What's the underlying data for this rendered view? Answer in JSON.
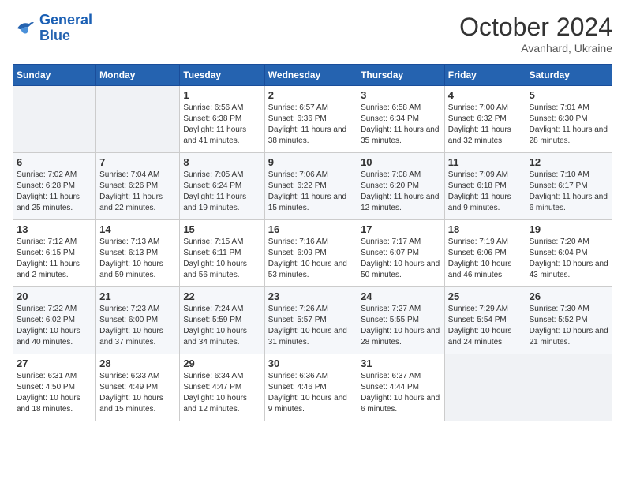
{
  "logo": {
    "text_general": "General",
    "text_blue": "Blue"
  },
  "header": {
    "month": "October 2024",
    "location": "Avanhard, Ukraine"
  },
  "weekdays": [
    "Sunday",
    "Monday",
    "Tuesday",
    "Wednesday",
    "Thursday",
    "Friday",
    "Saturday"
  ],
  "weeks": [
    [
      {
        "day": "",
        "empty": true
      },
      {
        "day": "",
        "empty": true
      },
      {
        "day": "1",
        "sunrise": "Sunrise: 6:56 AM",
        "sunset": "Sunset: 6:38 PM",
        "daylight": "Daylight: 11 hours and 41 minutes."
      },
      {
        "day": "2",
        "sunrise": "Sunrise: 6:57 AM",
        "sunset": "Sunset: 6:36 PM",
        "daylight": "Daylight: 11 hours and 38 minutes."
      },
      {
        "day": "3",
        "sunrise": "Sunrise: 6:58 AM",
        "sunset": "Sunset: 6:34 PM",
        "daylight": "Daylight: 11 hours and 35 minutes."
      },
      {
        "day": "4",
        "sunrise": "Sunrise: 7:00 AM",
        "sunset": "Sunset: 6:32 PM",
        "daylight": "Daylight: 11 hours and 32 minutes."
      },
      {
        "day": "5",
        "sunrise": "Sunrise: 7:01 AM",
        "sunset": "Sunset: 6:30 PM",
        "daylight": "Daylight: 11 hours and 28 minutes."
      }
    ],
    [
      {
        "day": "6",
        "sunrise": "Sunrise: 7:02 AM",
        "sunset": "Sunset: 6:28 PM",
        "daylight": "Daylight: 11 hours and 25 minutes."
      },
      {
        "day": "7",
        "sunrise": "Sunrise: 7:04 AM",
        "sunset": "Sunset: 6:26 PM",
        "daylight": "Daylight: 11 hours and 22 minutes."
      },
      {
        "day": "8",
        "sunrise": "Sunrise: 7:05 AM",
        "sunset": "Sunset: 6:24 PM",
        "daylight": "Daylight: 11 hours and 19 minutes."
      },
      {
        "day": "9",
        "sunrise": "Sunrise: 7:06 AM",
        "sunset": "Sunset: 6:22 PM",
        "daylight": "Daylight: 11 hours and 15 minutes."
      },
      {
        "day": "10",
        "sunrise": "Sunrise: 7:08 AM",
        "sunset": "Sunset: 6:20 PM",
        "daylight": "Daylight: 11 hours and 12 minutes."
      },
      {
        "day": "11",
        "sunrise": "Sunrise: 7:09 AM",
        "sunset": "Sunset: 6:18 PM",
        "daylight": "Daylight: 11 hours and 9 minutes."
      },
      {
        "day": "12",
        "sunrise": "Sunrise: 7:10 AM",
        "sunset": "Sunset: 6:17 PM",
        "daylight": "Daylight: 11 hours and 6 minutes."
      }
    ],
    [
      {
        "day": "13",
        "sunrise": "Sunrise: 7:12 AM",
        "sunset": "Sunset: 6:15 PM",
        "daylight": "Daylight: 11 hours and 2 minutes."
      },
      {
        "day": "14",
        "sunrise": "Sunrise: 7:13 AM",
        "sunset": "Sunset: 6:13 PM",
        "daylight": "Daylight: 10 hours and 59 minutes."
      },
      {
        "day": "15",
        "sunrise": "Sunrise: 7:15 AM",
        "sunset": "Sunset: 6:11 PM",
        "daylight": "Daylight: 10 hours and 56 minutes."
      },
      {
        "day": "16",
        "sunrise": "Sunrise: 7:16 AM",
        "sunset": "Sunset: 6:09 PM",
        "daylight": "Daylight: 10 hours and 53 minutes."
      },
      {
        "day": "17",
        "sunrise": "Sunrise: 7:17 AM",
        "sunset": "Sunset: 6:07 PM",
        "daylight": "Daylight: 10 hours and 50 minutes."
      },
      {
        "day": "18",
        "sunrise": "Sunrise: 7:19 AM",
        "sunset": "Sunset: 6:06 PM",
        "daylight": "Daylight: 10 hours and 46 minutes."
      },
      {
        "day": "19",
        "sunrise": "Sunrise: 7:20 AM",
        "sunset": "Sunset: 6:04 PM",
        "daylight": "Daylight: 10 hours and 43 minutes."
      }
    ],
    [
      {
        "day": "20",
        "sunrise": "Sunrise: 7:22 AM",
        "sunset": "Sunset: 6:02 PM",
        "daylight": "Daylight: 10 hours and 40 minutes."
      },
      {
        "day": "21",
        "sunrise": "Sunrise: 7:23 AM",
        "sunset": "Sunset: 6:00 PM",
        "daylight": "Daylight: 10 hours and 37 minutes."
      },
      {
        "day": "22",
        "sunrise": "Sunrise: 7:24 AM",
        "sunset": "Sunset: 5:59 PM",
        "daylight": "Daylight: 10 hours and 34 minutes."
      },
      {
        "day": "23",
        "sunrise": "Sunrise: 7:26 AM",
        "sunset": "Sunset: 5:57 PM",
        "daylight": "Daylight: 10 hours and 31 minutes."
      },
      {
        "day": "24",
        "sunrise": "Sunrise: 7:27 AM",
        "sunset": "Sunset: 5:55 PM",
        "daylight": "Daylight: 10 hours and 28 minutes."
      },
      {
        "day": "25",
        "sunrise": "Sunrise: 7:29 AM",
        "sunset": "Sunset: 5:54 PM",
        "daylight": "Daylight: 10 hours and 24 minutes."
      },
      {
        "day": "26",
        "sunrise": "Sunrise: 7:30 AM",
        "sunset": "Sunset: 5:52 PM",
        "daylight": "Daylight: 10 hours and 21 minutes."
      }
    ],
    [
      {
        "day": "27",
        "sunrise": "Sunrise: 6:31 AM",
        "sunset": "Sunset: 4:50 PM",
        "daylight": "Daylight: 10 hours and 18 minutes."
      },
      {
        "day": "28",
        "sunrise": "Sunrise: 6:33 AM",
        "sunset": "Sunset: 4:49 PM",
        "daylight": "Daylight: 10 hours and 15 minutes."
      },
      {
        "day": "29",
        "sunrise": "Sunrise: 6:34 AM",
        "sunset": "Sunset: 4:47 PM",
        "daylight": "Daylight: 10 hours and 12 minutes."
      },
      {
        "day": "30",
        "sunrise": "Sunrise: 6:36 AM",
        "sunset": "Sunset: 4:46 PM",
        "daylight": "Daylight: 10 hours and 9 minutes."
      },
      {
        "day": "31",
        "sunrise": "Sunrise: 6:37 AM",
        "sunset": "Sunset: 4:44 PM",
        "daylight": "Daylight: 10 hours and 6 minutes."
      },
      {
        "day": "",
        "empty": true
      },
      {
        "day": "",
        "empty": true
      }
    ]
  ]
}
